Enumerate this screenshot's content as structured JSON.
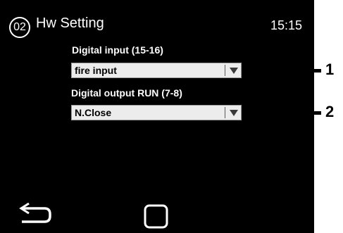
{
  "header": {
    "screen_number": "02",
    "title": "Hw Setting",
    "time": "15:15"
  },
  "fields": {
    "digital_input": {
      "label": "Digital input (15-16)",
      "value": "fire input"
    },
    "digital_output": {
      "label": "Digital output RUN (7-8)",
      "value": "N.Close"
    }
  },
  "footer": {
    "back_icon": "back-arrow-icon",
    "home_icon": "square-home-icon"
  },
  "callouts": [
    "1",
    "2"
  ],
  "colors": {
    "screen_background": "#000000",
    "foreground": "#ffffff",
    "dropdown_background": "#ececec"
  }
}
